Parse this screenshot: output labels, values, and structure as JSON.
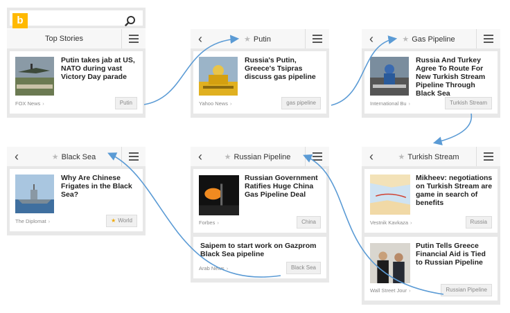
{
  "search": {
    "logo": "b",
    "query": ""
  },
  "panels": {
    "top": {
      "title": "Top Stories",
      "card": {
        "headline": "Putin takes jab at US, NATO during vast Victory Day parade",
        "source": "FOX News",
        "tag": "Putin"
      }
    },
    "putin": {
      "title": "Putin",
      "card": {
        "headline": "Russia's Putin, Greece's Tsipras discuss gas pipeline",
        "source": "Yahoo News",
        "tag": "gas pipeline"
      }
    },
    "gas": {
      "title": "Gas Pipeline",
      "card": {
        "headline": "Russia And Turkey Agree To Route For New Turkish Stream Pipeline Through Black Sea",
        "source": "International Bu",
        "tag": "Turkish Stream"
      }
    },
    "blacksea": {
      "title": "Black Sea",
      "card": {
        "headline": "Why Are Chinese Frigates in the Black Sea?",
        "source": "The Diplomat",
        "tag": "World"
      }
    },
    "russian": {
      "title": "Russian Pipeline",
      "card1": {
        "headline": "Russian Government Ratifies Huge China Gas Pipeline Deal",
        "source": "Forbes",
        "tag": "China"
      },
      "card2": {
        "headline": "Saipem to start work on Gazprom Black Sea pipeline",
        "source": "Arab News",
        "tag": "Black Sea"
      }
    },
    "turkish": {
      "title": "Turkish Stream",
      "card1": {
        "headline": "Mikheev: negotiations on Turkish Stream are game in search of benefits",
        "source": "Vestnik Kavkaza",
        "tag": "Russia"
      },
      "card2": {
        "headline": "Putin Tells Greece Financial Aid is Tied to Russian Pipeline",
        "source": "Wall Street Jour",
        "tag": "Russian Pipeline"
      }
    }
  },
  "ui": {
    "back_glyph": "‹",
    "star_glyph": "★",
    "more_glyph": "›"
  },
  "colors": {
    "accent": "#ffb900",
    "arrow": "#5b9bd5",
    "tag_star": "#f0a800"
  }
}
